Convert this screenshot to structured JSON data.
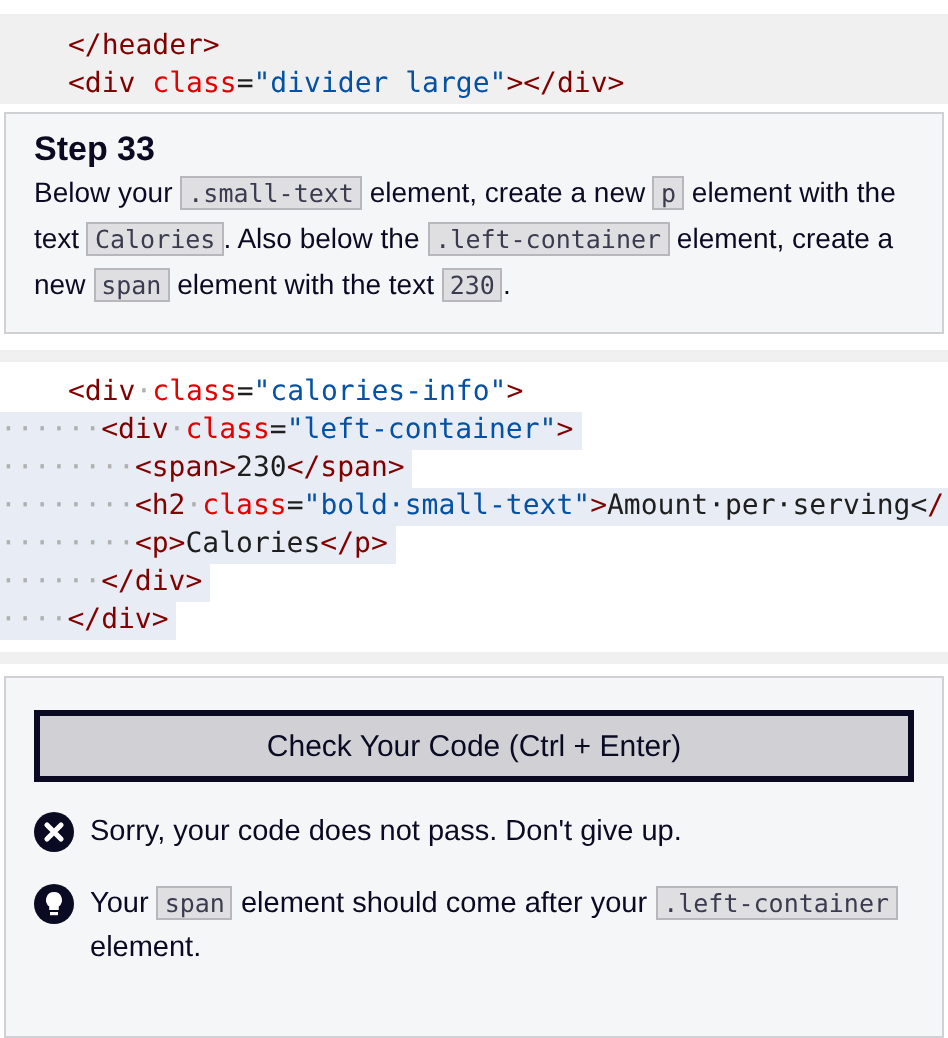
{
  "editor_top": {
    "lines": [
      {
        "tokens": [
          {
            "kind": "tag",
            "text": "</header>"
          }
        ]
      },
      {
        "tokens": [
          {
            "kind": "tag",
            "text": "<div "
          },
          {
            "kind": "attr",
            "text": "class"
          },
          {
            "kind": "plain",
            "text": "="
          },
          {
            "kind": "string",
            "text": "\"divider large\""
          },
          {
            "kind": "tag",
            "text": "></div>"
          }
        ]
      }
    ]
  },
  "step": {
    "title": "Step 33",
    "parts": [
      {
        "kind": "text",
        "text": "Below your "
      },
      {
        "kind": "code",
        "text": ".small-text"
      },
      {
        "kind": "text",
        "text": " element, create a new "
      },
      {
        "kind": "code",
        "text": "p"
      },
      {
        "kind": "text",
        "text": " element with the text "
      },
      {
        "kind": "code",
        "text": "Calories"
      },
      {
        "kind": "text",
        "text": ". Also below the "
      },
      {
        "kind": "code",
        "text": ".left-container"
      },
      {
        "kind": "text",
        "text": " element, create a new "
      },
      {
        "kind": "code",
        "text": "span"
      },
      {
        "kind": "text",
        "text": " element with the text "
      },
      {
        "kind": "code",
        "text": "230"
      },
      {
        "kind": "text",
        "text": "."
      }
    ]
  },
  "editor": {
    "lines": [
      {
        "highlighted": false,
        "tokens": [
          {
            "kind": "tag",
            "text": "<div"
          },
          {
            "kind": "ws",
            "text": "·"
          },
          {
            "kind": "attr",
            "text": "class"
          },
          {
            "kind": "plain",
            "text": "="
          },
          {
            "kind": "string",
            "text": "\"calories-info\""
          },
          {
            "kind": "tag",
            "text": ">"
          }
        ]
      },
      {
        "highlighted": true,
        "tokens": [
          {
            "kind": "ws",
            "text": "······"
          },
          {
            "kind": "tag",
            "text": "<div"
          },
          {
            "kind": "ws",
            "text": "·"
          },
          {
            "kind": "attr",
            "text": "class"
          },
          {
            "kind": "plain",
            "text": "="
          },
          {
            "kind": "string",
            "text": "\"left-container\""
          },
          {
            "kind": "tag",
            "text": ">"
          }
        ]
      },
      {
        "highlighted": true,
        "tokens": [
          {
            "kind": "ws",
            "text": "········"
          },
          {
            "kind": "tag",
            "text": "<span>"
          },
          {
            "kind": "plain",
            "text": "230"
          },
          {
            "kind": "tag",
            "text": "</span>"
          }
        ]
      },
      {
        "highlighted": true,
        "tokens": [
          {
            "kind": "ws",
            "text": "········"
          },
          {
            "kind": "tag",
            "text": "<h2"
          },
          {
            "kind": "ws",
            "text": "·"
          },
          {
            "kind": "attr",
            "text": "class"
          },
          {
            "kind": "plain",
            "text": "="
          },
          {
            "kind": "string",
            "text": "\"bold·small-text\""
          },
          {
            "kind": "tag",
            "text": ">"
          },
          {
            "kind": "plain",
            "text": "Amount·per·serving<"
          },
          {
            "kind": "tag",
            "text": "/"
          }
        ]
      },
      {
        "highlighted": true,
        "tokens": [
          {
            "kind": "ws",
            "text": "········"
          },
          {
            "kind": "tag",
            "text": "<p>"
          },
          {
            "kind": "plain",
            "text": "Calories"
          },
          {
            "kind": "tag",
            "text": "</p>"
          }
        ]
      },
      {
        "highlighted": true,
        "tokens": [
          {
            "kind": "ws",
            "text": "······"
          },
          {
            "kind": "tag",
            "text": "</div>"
          }
        ]
      },
      {
        "highlighted": true,
        "tokens": [
          {
            "kind": "ws",
            "text": "····"
          },
          {
            "kind": "tag",
            "text": "</div>"
          }
        ]
      }
    ]
  },
  "check_button": "Check Your Code (Ctrl + Enter)",
  "messages": [
    {
      "kind": "error",
      "parts": [
        {
          "kind": "text",
          "text": "Sorry, your code does not pass. Don't give up."
        }
      ]
    },
    {
      "kind": "hint",
      "parts": [
        {
          "kind": "text",
          "text": "Your "
        },
        {
          "kind": "code",
          "text": "span"
        },
        {
          "kind": "text",
          "text": " element should come after your "
        },
        {
          "kind": "code",
          "text": ".left-container"
        },
        {
          "kind": "text",
          "text": " element."
        }
      ]
    }
  ]
}
